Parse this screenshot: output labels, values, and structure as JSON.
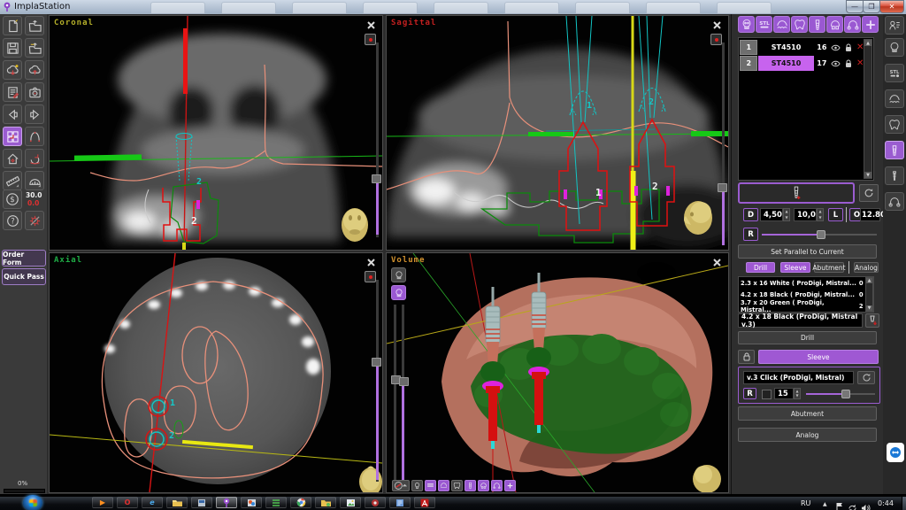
{
  "window": {
    "title": "ImplaStation"
  },
  "colors": {
    "accent": "#a05ad6",
    "selected_row": "#c763ee",
    "coronal_label": "#b5b02a",
    "sagittal_label": "#c42020",
    "axial_label": "#1fae46",
    "volume_label": "#d0902e"
  },
  "left_toolbar": {
    "icons": [
      "new-project",
      "open-project",
      "save",
      "export-project",
      "cloud-download",
      "cloud-upload",
      "report",
      "snapshot",
      "undo",
      "redo",
      "layout-grid",
      "panoramic-curve",
      "reset-view",
      "rotate-view",
      "ruler",
      "protractor",
      "price",
      "help",
      "settings"
    ],
    "price_main": "30.0",
    "price_alt": "0.0",
    "order_form_label": "Order Form",
    "quick_pass_label": "Quick Pass",
    "progress_label": "0%"
  },
  "viewports": {
    "coronal": {
      "label": "Coronal"
    },
    "sagittal": {
      "label": "Sagittal"
    },
    "axial": {
      "label": "Axial"
    },
    "volume": {
      "label": "Volume"
    }
  },
  "markers": {
    "one": "1",
    "two": "2"
  },
  "implant_panel": {
    "toolbar_icons": [
      "skull",
      "stl",
      "teeth-row",
      "tooth",
      "implant",
      "denture",
      "arch",
      "add-implant"
    ],
    "rows": [
      {
        "index": "1",
        "name": "ST4510",
        "tooth": "16"
      },
      {
        "index": "2",
        "name": "ST4510",
        "tooth": "17"
      }
    ],
    "d_label": "D",
    "d_value": "4,50",
    "len_value": "10,0",
    "l_label": "L",
    "o_label": "O",
    "o_value": "12.80",
    "r_label": "R",
    "set_parallel_label": "Set Parallel to Current",
    "tabs": [
      "Drill",
      "Sleeve",
      "Abutment",
      "Analog"
    ]
  },
  "drill": {
    "items": [
      {
        "text": "2.3 x 16  White ( ProDigi, Mistral...",
        "count": "0"
      },
      {
        "text": "4.2 x 18  Black ( ProDigi, Mistral...",
        "count": "0"
      },
      {
        "text": "3.7 x 20  Green ( ProDigi, Mistral...",
        "count": "2"
      }
    ],
    "selected": "4.2 x 18  Black (ProDigi, Mistral v.3)",
    "apply_label": "Drill"
  },
  "sleeve": {
    "header_label": "Sleeve",
    "selected": "v.3 Click (ProDigi, Mistral)",
    "r_label": "R",
    "depth_value": "15"
  },
  "abutment": {
    "label": "Abutment"
  },
  "analog": {
    "label": "Analog"
  },
  "right_sidebar": {
    "icons": [
      "patient",
      "skull",
      "stl",
      "teeth-row",
      "tooth",
      "implant",
      "screw",
      "arch"
    ]
  },
  "taskbar": {
    "language": "RU",
    "time": "0:44",
    "apps": [
      "media-player",
      "opera",
      "internet-explorer",
      "explorer",
      "viewer",
      "implastation",
      "paint",
      "task-list",
      "chrome",
      "shared-folder",
      "photo-viewer",
      "recorder",
      "notes",
      "acrobat"
    ]
  }
}
